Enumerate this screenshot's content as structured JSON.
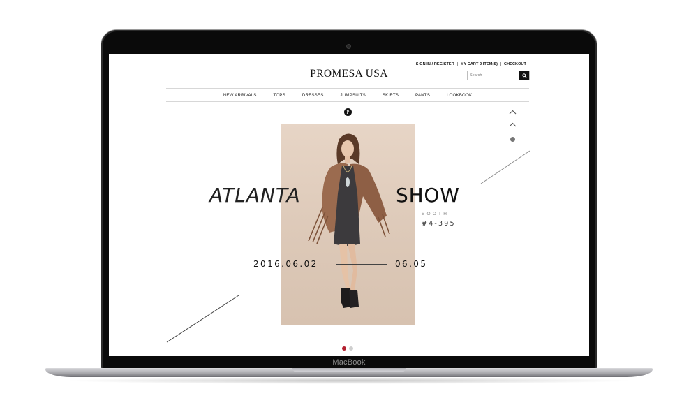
{
  "device": {
    "brand_label": "MacBook"
  },
  "site": {
    "logo": "PROMESA USA",
    "utility_links": [
      "SIGN IN / REGISTER",
      "MY CART 0 ITEM(S)",
      "CHECKOUT"
    ],
    "search": {
      "placeholder": "Search",
      "button_icon": "search-icon"
    },
    "nav": [
      "NEW ARRIVALS",
      "TOPS",
      "DRESSES",
      "JUMPSUITS",
      "SKIRTS",
      "PANTS",
      "LOOKBOOK"
    ],
    "monogram": "P"
  },
  "hero": {
    "word_left": "ATLANTA",
    "word_right": "SHOW",
    "booth_label": "BOOTH",
    "booth_number": "#4-395",
    "date_start": "2016.06.02",
    "date_end": "06.05"
  },
  "slider": {
    "dot_count": 2,
    "active_index": 0
  },
  "colors": {
    "screen_bg": "#ffffff",
    "photo_bg": "#dcc8b7",
    "active_dot": "#b3202f",
    "inactive_dot": "#cfcfcf",
    "text": "#111111"
  }
}
